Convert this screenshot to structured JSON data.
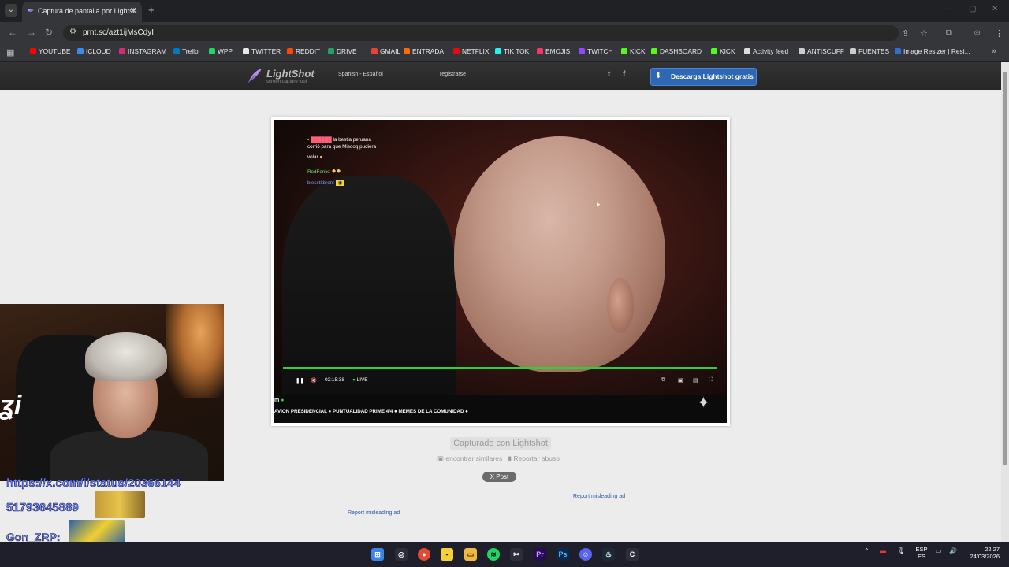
{
  "browser": {
    "tab_title": "Captura de pantalla por Lightsh",
    "url": "prnt.sc/azt1ijMsCdyI",
    "bookmarks": [
      {
        "label": "YOUTUBE",
        "color": "#ff0000"
      },
      {
        "label": "ICLOUD",
        "color": "#3d8be8"
      },
      {
        "label": "INSTAGRAM",
        "color": "#d62976"
      },
      {
        "label": "Trello",
        "color": "#0079bf"
      },
      {
        "label": "WPP",
        "color": "#25d366"
      },
      {
        "label": "TWITTER",
        "color": "#e8e8e8"
      },
      {
        "label": "REDDIT",
        "color": "#ff4500"
      },
      {
        "label": "DRIVE",
        "color": "#1fa463"
      },
      {
        "label": "GMAIL",
        "color": "#ea4335"
      },
      {
        "label": "ENTRADA",
        "color": "#ff6a00"
      },
      {
        "label": "NETFLIX",
        "color": "#e50914"
      },
      {
        "label": "TIK TOK",
        "color": "#25f4ee"
      },
      {
        "label": "EMOJIS",
        "color": "#ff3366"
      },
      {
        "label": "TWITCH",
        "color": "#9146ff"
      },
      {
        "label": "KICK",
        "color": "#53fc18"
      },
      {
        "label": "DASHBOARD",
        "color": "#53fc18"
      },
      {
        "label": "KICK",
        "color": "#53fc18"
      },
      {
        "label": "Activity feed",
        "color": "#dddddd"
      },
      {
        "label": "ANTISCUFF",
        "color": "#cccccc"
      },
      {
        "label": "FUENTES",
        "color": "#cccccc"
      },
      {
        "label": "Image Resizer | Resi...",
        "color": "#2f6fd6"
      }
    ]
  },
  "lightshot": {
    "logo_name": "LightShot",
    "logo_sub": "screen capture tool",
    "language": "Spanish - Español",
    "register": "registrarse",
    "twitter_icon": "t",
    "facebook_icon": "f",
    "download_label": "Descarga Lightshot gratis",
    "captured_label": "Capturado con Lightshot",
    "find_similar": "encontrar similares",
    "report_abuse": "Reportar abuso",
    "post_button": "X Post",
    "report_ad_1": "Report misleading ad",
    "report_ad_2": "Report misleading ad"
  },
  "screenshot": {
    "chat": [
      {
        "name": "",
        "text": "la bestia peruana"
      },
      {
        "name": "",
        "text": "corrió para que Misooq pudiera"
      },
      {
        "name": "",
        "text": "volar"
      },
      {
        "name": "RedFenix:",
        "text": ""
      },
      {
        "name": "blesstkbron:",
        "text": ""
      }
    ],
    "time": "02:15:38",
    "live": "LIVE",
    "ticker_m": "m",
    "ticker": "AVION PRESIDENCIAL ● PUNTUALIDAD PRIME 4/4 ● MEMES DE LA COMUNIDAD ●"
  },
  "overlay": {
    "url_text": "https://x.com/i/status/20366144",
    "number_text": "51793645889",
    "name_text": "Gon_ZRP:"
  },
  "taskbar": {
    "lang_top": "ESP",
    "lang_bottom": "ES",
    "time": "22:27",
    "date": "24/03/2026"
  }
}
